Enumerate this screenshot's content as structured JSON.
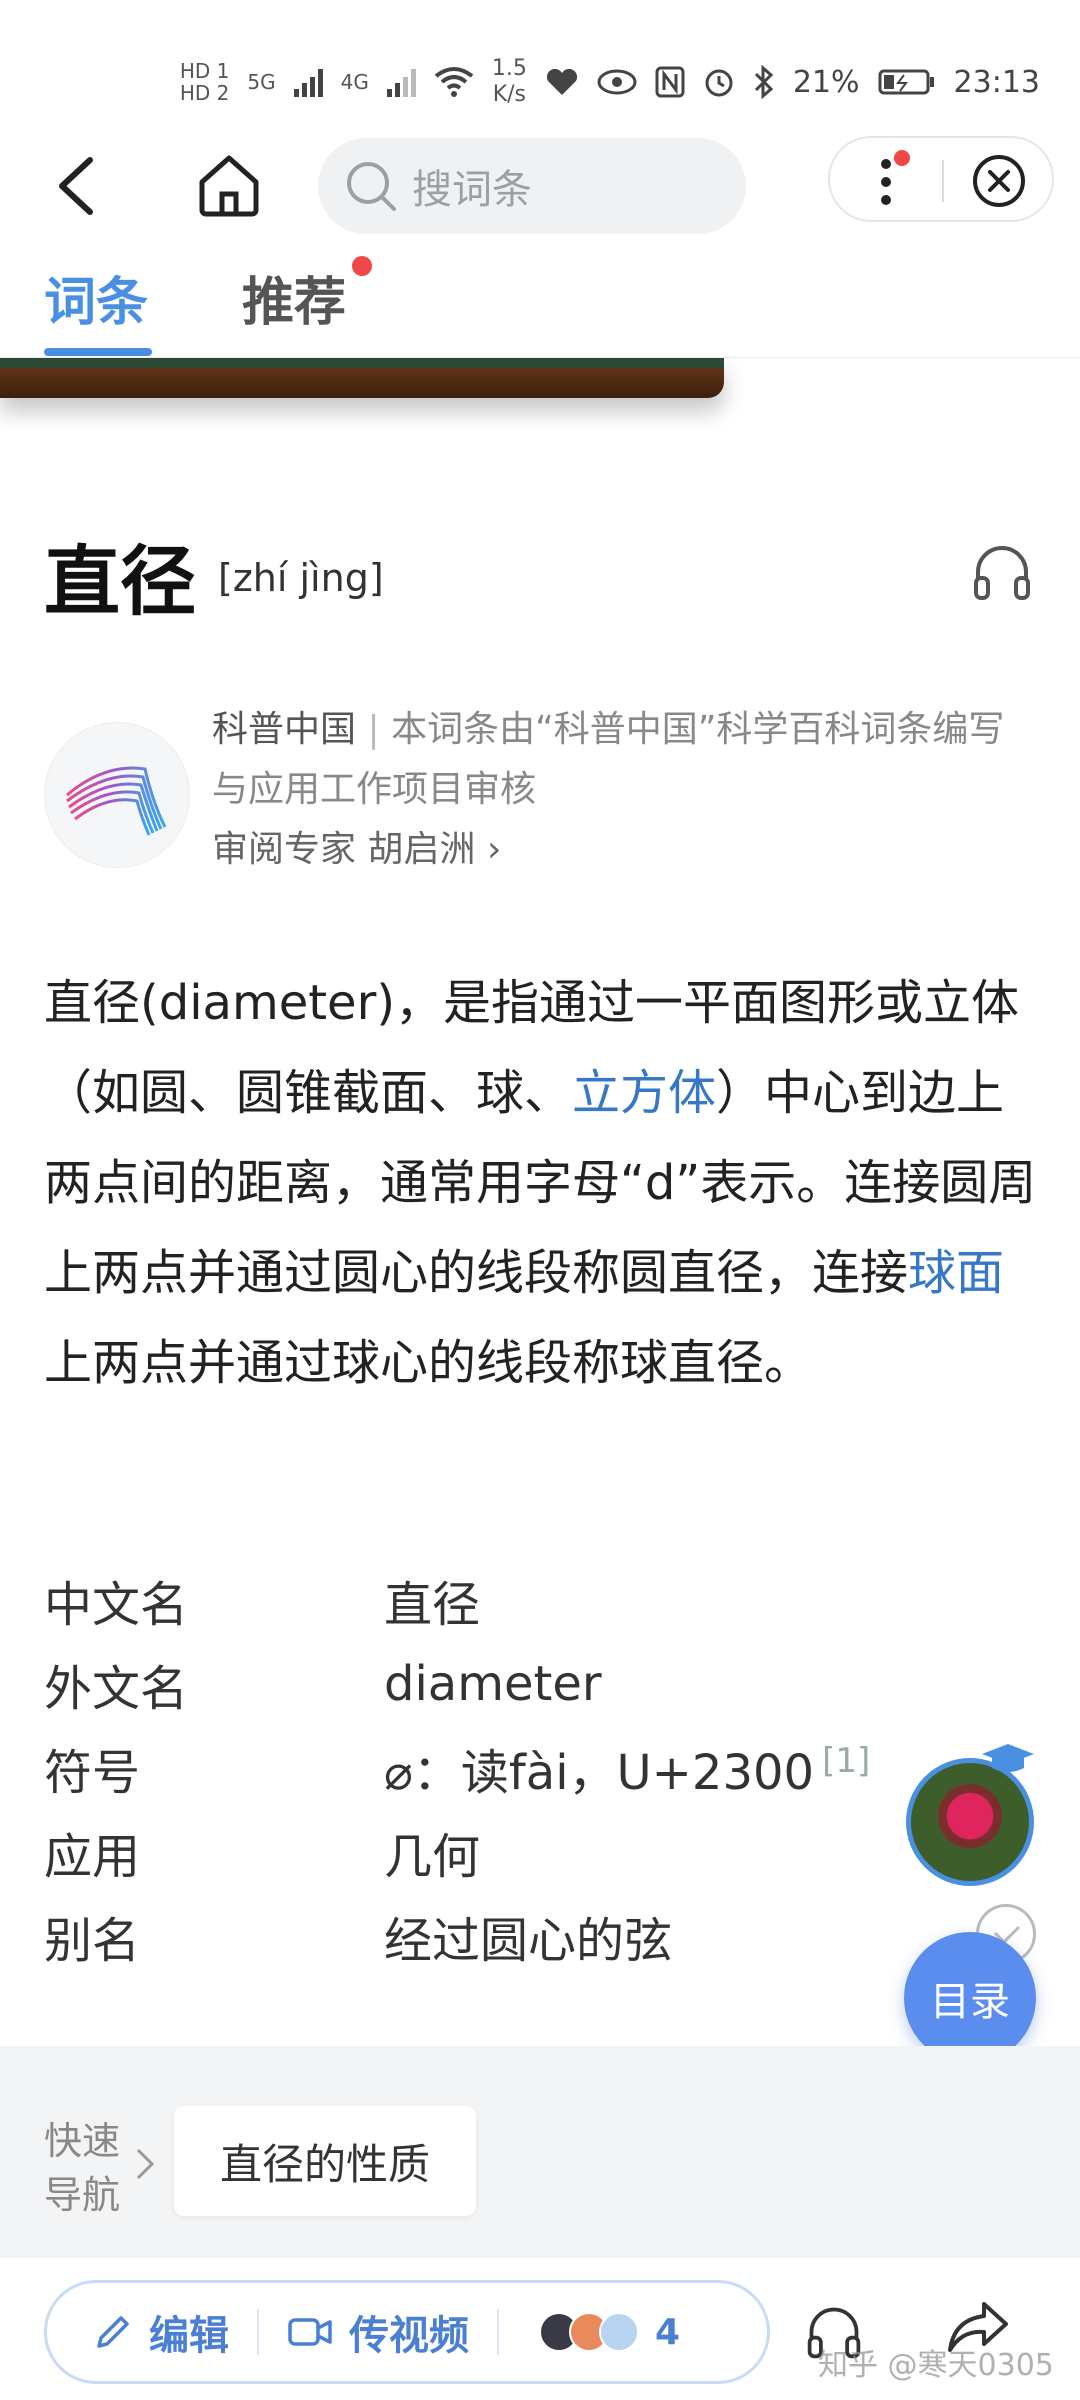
{
  "status_bar": {
    "hd1": "HD 1",
    "hd2": "HD 2",
    "net_5g": "5G",
    "net_4g": "4G",
    "speed": "1.5",
    "speed_unit": "K/s",
    "battery": "21%",
    "time": "23:13"
  },
  "nav": {
    "search_placeholder": "搜词条"
  },
  "tabs": [
    "词条",
    "推荐"
  ],
  "entry": {
    "title": "直径",
    "pinyin": "[zhí jìng]"
  },
  "authority": {
    "org": "科普中国",
    "separator": "|",
    "desc": "本词条由“科普中国”科学百科词条编写与应用工作项目审核",
    "expert_label": "审阅专家",
    "expert_name": "胡启洲",
    "arrow": "›"
  },
  "summary": {
    "p1": "直径(diameter)，是指通过一平面图形或立体（如圆、圆锥截面、球、",
    "link1": "立方体",
    "p2": "）中心到边上两点间的距离，通常用字母“d”表示。连接圆周上两点并通过圆心的线段称圆直径，连接",
    "link2": "球面",
    "p3": "上两点并通过球心的线段称球直径。"
  },
  "basic_info": [
    {
      "key": "中文名",
      "value": "直径",
      "ref": ""
    },
    {
      "key": "外文名",
      "value": "diameter",
      "ref": ""
    },
    {
      "key": "符号",
      "value": "⌀：读fài，U+2300",
      "ref": "[1]"
    },
    {
      "key": "应用",
      "value": "几何",
      "ref": ""
    },
    {
      "key": "别名",
      "value": "经过圆心的弦",
      "ref": ""
    }
  ],
  "floating": {
    "toc_label": "目录"
  },
  "quick_nav": {
    "label_line1": "快速",
    "label_line2": "导航",
    "chip": "直径的性质"
  },
  "bottom_bar": {
    "edit_label": "编辑",
    "video_label": "传视频",
    "contributors_count": "4",
    "watermark": "知乎 @寒天0305"
  },
  "colors": {
    "accent": "#4a90e2",
    "link": "#3677c7",
    "badge_red": "#f04848",
    "toc_bg": "#5b8def"
  }
}
